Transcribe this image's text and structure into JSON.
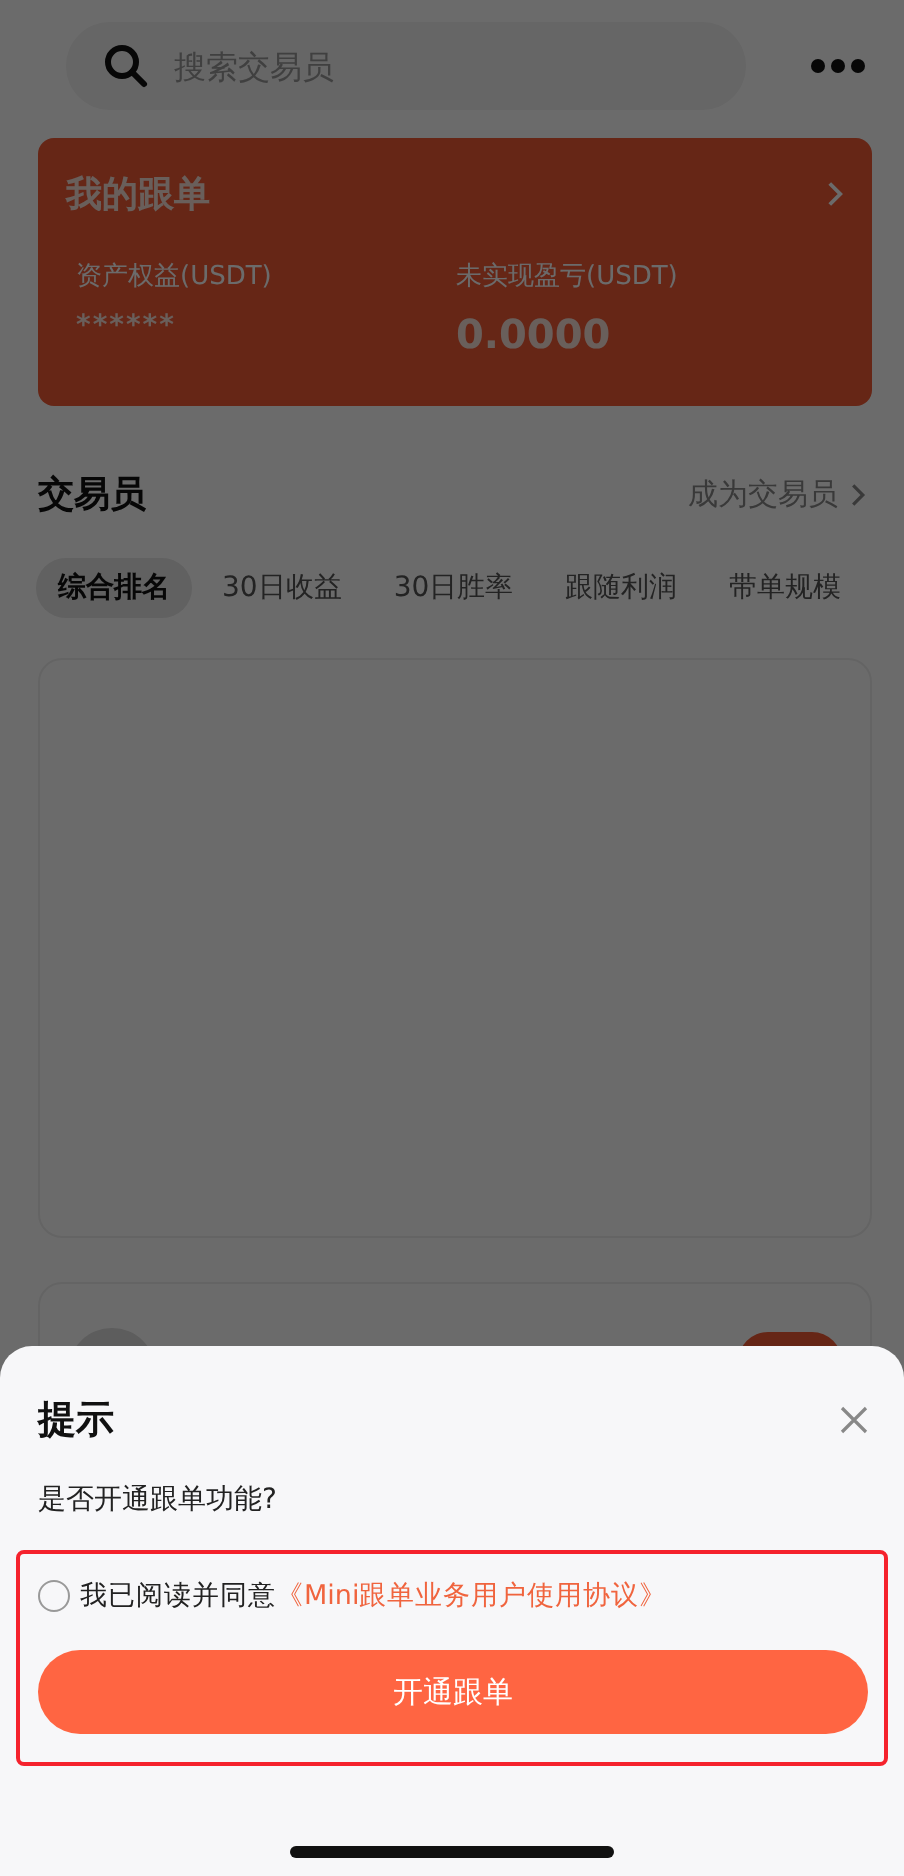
{
  "search": {
    "placeholder": "搜索交易员"
  },
  "my_copy_card": {
    "title": "我的跟单",
    "stats": [
      {
        "label": "资产权益(USDT)",
        "value": "******",
        "kind": "masked"
      },
      {
        "label": "未实现盈亏(USDT)",
        "value": "0.0000",
        "kind": "number"
      }
    ]
  },
  "traders": {
    "title": "交易员",
    "action": "成为交易员"
  },
  "tabs": [
    {
      "label": "综合排名",
      "selected": true
    },
    {
      "label": "30日收益",
      "selected": false
    },
    {
      "label": "30日胜率",
      "selected": false
    },
    {
      "label": "跟随利润",
      "selected": false
    },
    {
      "label": "带单规模",
      "selected": false
    }
  ],
  "dialog": {
    "title": "提示",
    "message": "是否开通跟单功能?",
    "agreement": {
      "checked": false,
      "text": "我已阅读并同意",
      "link": "《Mini跟单业务用户使用协议》"
    },
    "button": "开通跟单"
  }
}
